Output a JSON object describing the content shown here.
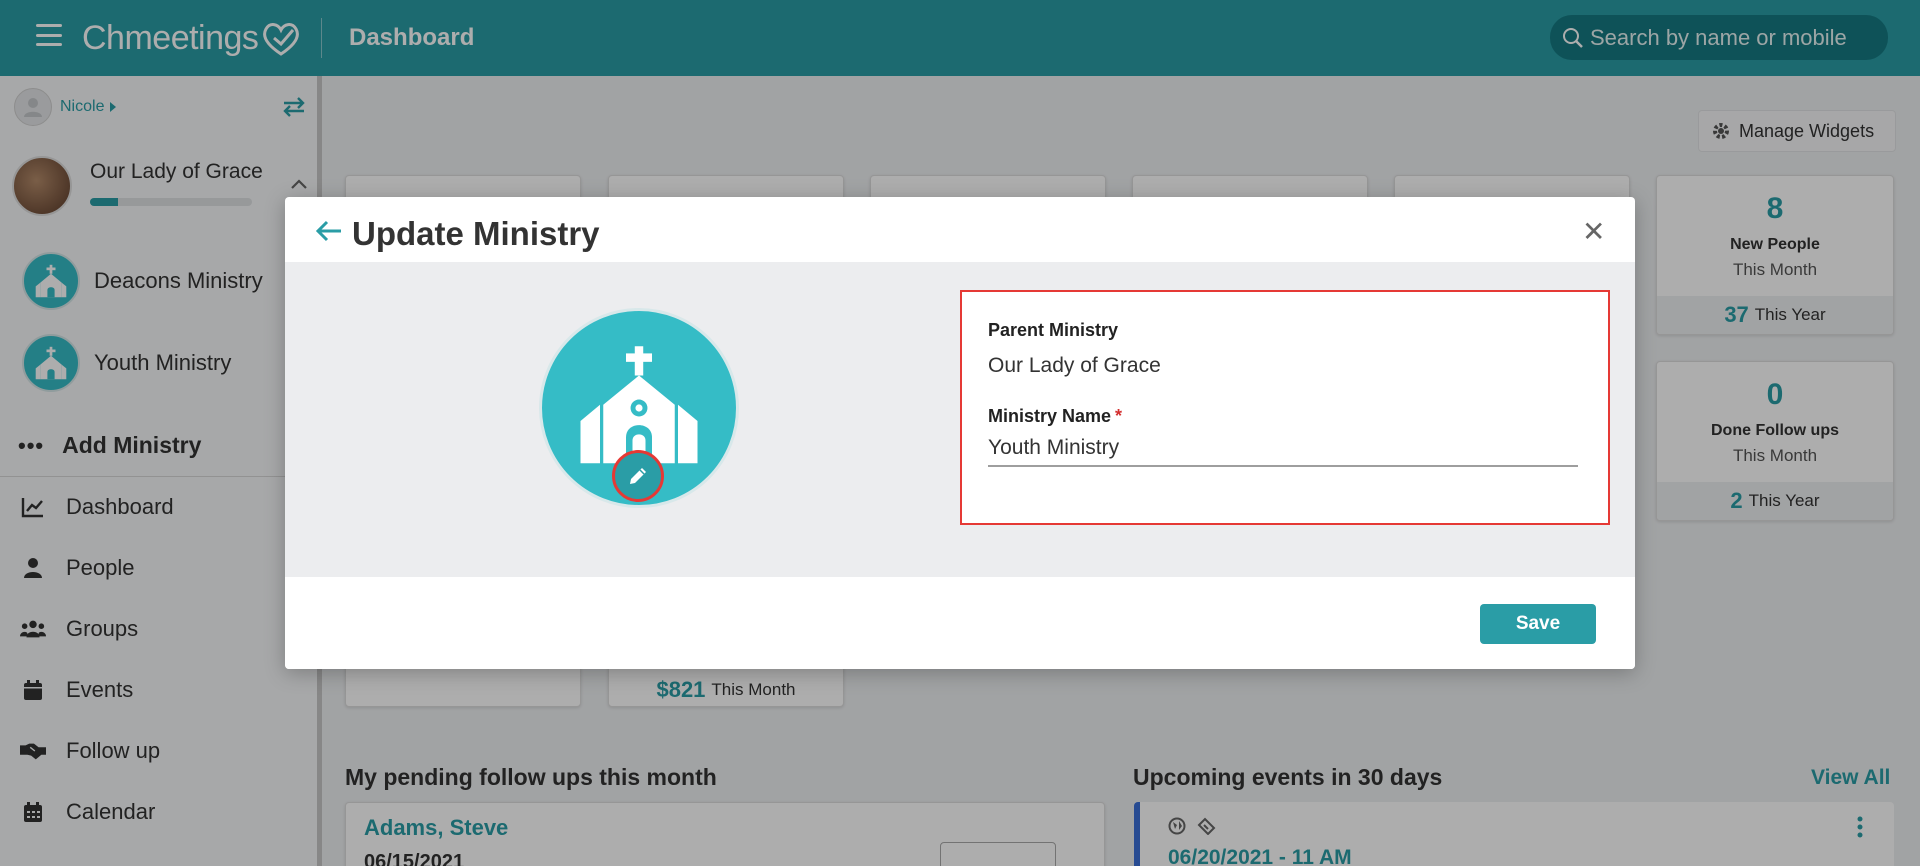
{
  "app": {
    "logo_text": "Chmeetings",
    "page_title": "Dashboard",
    "search_placeholder": "Search by name or mobile"
  },
  "sidebar": {
    "user_name": "Nicole",
    "org_name": "Our Lady of Grace",
    "org_progress": 0.17,
    "ministries": [
      {
        "label": "Deacons Ministry"
      },
      {
        "label": "Youth Ministry"
      }
    ],
    "add_ministry": "Add Ministry",
    "nav": [
      {
        "label": "Dashboard",
        "icon": "chart-line-icon"
      },
      {
        "label": "People",
        "icon": "person-icon"
      },
      {
        "label": "Groups",
        "icon": "users-icon"
      },
      {
        "label": "Events",
        "icon": "calendar-icon"
      },
      {
        "label": "Follow up",
        "icon": "handshake-icon"
      },
      {
        "label": "Calendar",
        "icon": "calendar-grid-icon"
      }
    ]
  },
  "dashboard": {
    "manage_widgets": "Manage Widgets",
    "new_people": {
      "count": "8",
      "title": "New People",
      "period": "This Month",
      "year_count": "37",
      "year_label": "This Year"
    },
    "done_followups": {
      "count": "0",
      "title": "Done Follow ups",
      "period": "This Month",
      "year_count": "2",
      "year_label": "This Year"
    },
    "giving_month": {
      "amount": "$821",
      "label": "This Month"
    },
    "pending_title": "My pending follow ups this month",
    "events_title": "Upcoming events in 30 days",
    "view_all": "View All",
    "followup": {
      "name": "Adams, Steve",
      "date": "06/15/2021"
    },
    "event": {
      "date": "06/20/2021 - 11 AM"
    }
  },
  "modal": {
    "title": "Update Ministry",
    "parent_label": "Parent Ministry",
    "parent_value": "Our Lady of Grace",
    "name_label": "Ministry Name",
    "required_mark": "*",
    "name_value": "Youth Ministry",
    "save_label": "Save"
  },
  "colors": {
    "brand": "#2a9da6",
    "accent_light": "#35bcc6",
    "highlight": "#e53935"
  }
}
